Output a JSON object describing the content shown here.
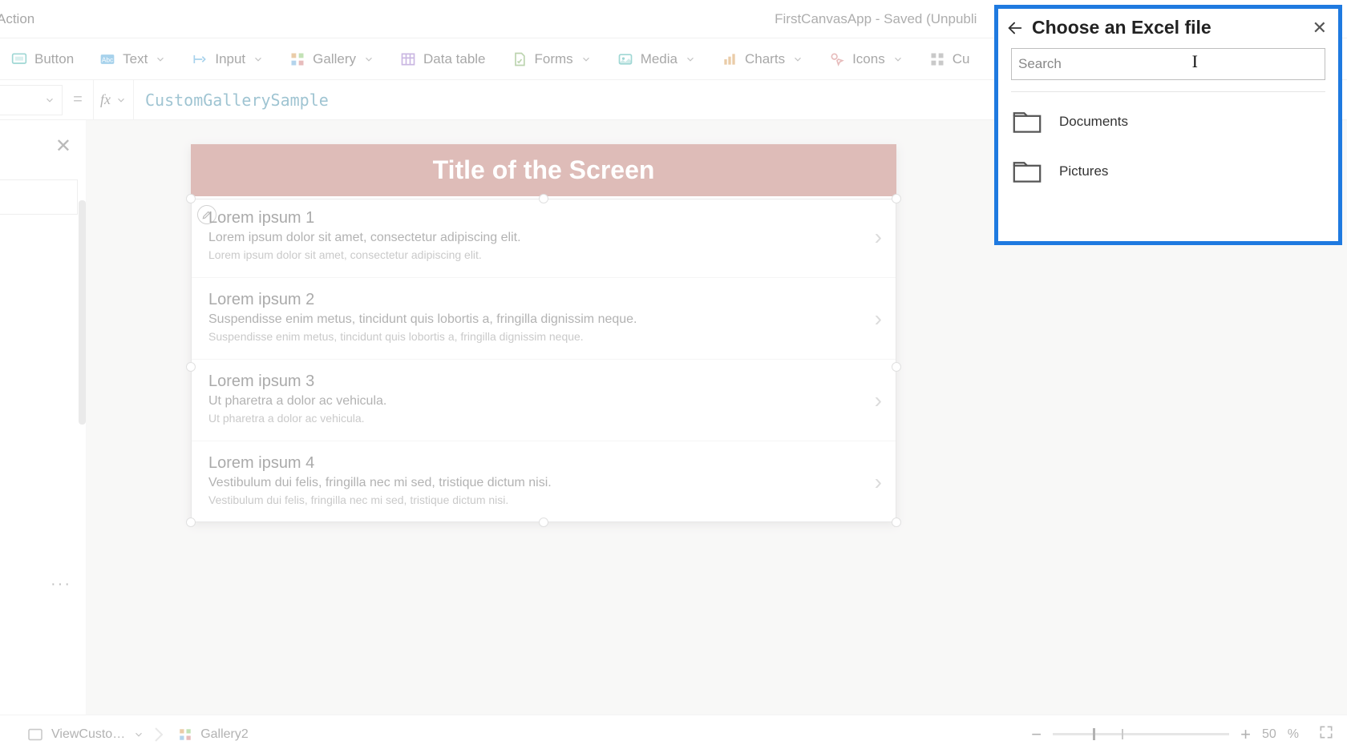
{
  "window": {
    "title": "FirstCanvasApp - Saved (Unpubli"
  },
  "menu": {
    "action": "Action"
  },
  "ribbon": {
    "button": "Button",
    "text": "Text",
    "input": "Input",
    "gallery": "Gallery",
    "data_table": "Data table",
    "forms": "Forms",
    "media": "Media",
    "charts": "Charts",
    "icons": "Icons",
    "custom": "Cu"
  },
  "formula": {
    "fx_label": "fx",
    "value": "CustomGallerySample"
  },
  "screen": {
    "title": "Title of the Screen",
    "items": [
      {
        "title": "Lorem ipsum 1",
        "sub": "Lorem ipsum dolor sit amet, consectetur adipiscing elit.",
        "body": "Lorem ipsum dolor sit amet, consectetur adipiscing elit."
      },
      {
        "title": "Lorem ipsum 2",
        "sub": "Suspendisse enim metus, tincidunt quis lobortis a, fringilla dignissim neque.",
        "body": "Suspendisse enim metus, tincidunt quis lobortis a, fringilla dignissim neque."
      },
      {
        "title": "Lorem ipsum 3",
        "sub": "Ut pharetra a dolor ac vehicula.",
        "body": "Ut pharetra a dolor ac vehicula."
      },
      {
        "title": "Lorem ipsum 4",
        "sub": "Vestibulum dui felis, fringilla nec mi sed, tristique dictum nisi.",
        "body": "Vestibulum dui felis, fringilla nec mi sed, tristique dictum nisi."
      }
    ]
  },
  "footer": {
    "crumb1": "ViewCusto…",
    "crumb2": "Gallery2",
    "zoom_value": "50",
    "zoom_unit": "%"
  },
  "picker": {
    "title": "Choose an Excel file",
    "search_placeholder": "Search",
    "folders": [
      {
        "name": "Documents"
      },
      {
        "name": "Pictures"
      }
    ]
  },
  "icons": {
    "chevron_right": "›",
    "minus": "−",
    "plus": "+"
  }
}
